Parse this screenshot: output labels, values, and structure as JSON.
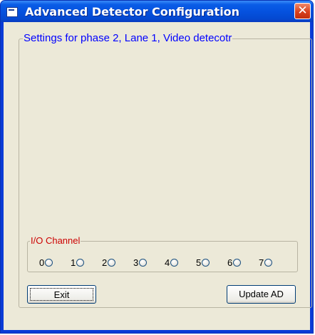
{
  "window": {
    "title": "Advanced Detector Configuration",
    "close_glyph": "✕"
  },
  "settings": {
    "legend": "Settings for phase 2, Lane 1, Video detecotr"
  },
  "io_channel": {
    "legend": "I/O Channel",
    "options": [
      {
        "label": "0",
        "checked": false
      },
      {
        "label": "1",
        "checked": false
      },
      {
        "label": "2",
        "checked": false
      },
      {
        "label": "3",
        "checked": false
      },
      {
        "label": "4",
        "checked": false
      },
      {
        "label": "5",
        "checked": false
      },
      {
        "label": "6",
        "checked": false
      },
      {
        "label": "7",
        "checked": false
      }
    ]
  },
  "buttons": {
    "exit_label": "Exit",
    "update_label": "Update AD"
  },
  "colors": {
    "titlebar": "#0552df",
    "legend_settings": "#0000ff",
    "legend_io": "#cc0000",
    "client_bg": "#ece9d8"
  }
}
